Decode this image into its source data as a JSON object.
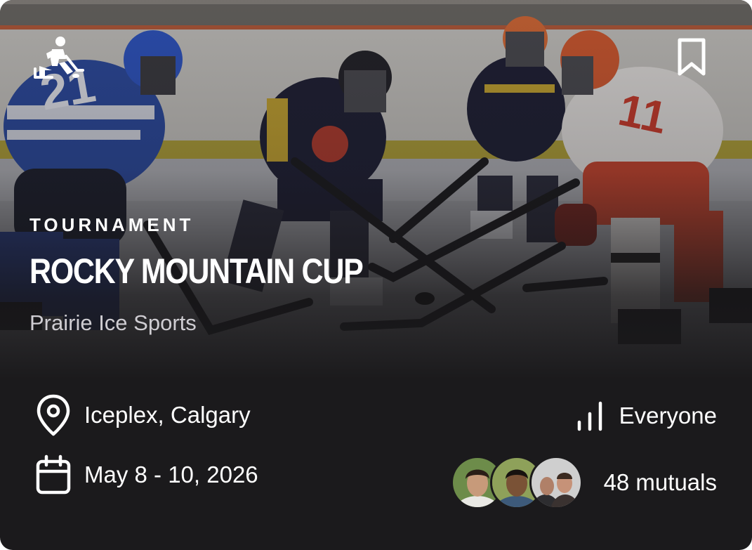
{
  "event": {
    "category": "TOURNAMENT",
    "title": "ROCKY MOUNTAIN CUP",
    "organizer": "Prairie Ice Sports",
    "location": "Iceplex, Calgary",
    "dates": "May 8 - 10, 2026",
    "level": "Everyone",
    "mutuals": "48 mutuals"
  },
  "icons": {
    "sport": "ice-hockey-icon",
    "bookmark": "bookmark-icon",
    "location": "location-pin-icon",
    "date": "calendar-icon",
    "level": "signal-bars-icon"
  },
  "avatars": [
    {
      "name": "mutual-avatar-1"
    },
    {
      "name": "mutual-avatar-2"
    },
    {
      "name": "mutual-avatar-3"
    }
  ],
  "colors": {
    "card_background": "#1b1a1c",
    "text_primary": "#ffffff",
    "text_secondary": "#cfcdd2"
  }
}
